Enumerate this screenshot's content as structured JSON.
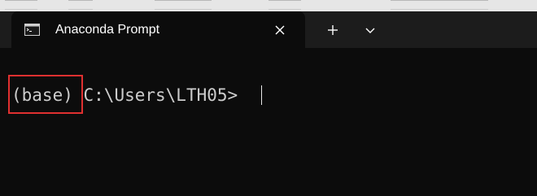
{
  "window": {
    "tab_title": "Anaconda Prompt",
    "tab_icon": "terminal-icon",
    "close_icon": "close-icon",
    "new_tab_icon": "plus-icon",
    "dropdown_icon": "chevron-down-icon"
  },
  "terminal": {
    "env_name": "(base)",
    "path": "C:\\Users\\LTH05>"
  },
  "colors": {
    "terminal_bg": "#0c0c0c",
    "titlebar_bg": "#1c1c1c",
    "text": "#cccccc",
    "highlight": "#e03030"
  }
}
